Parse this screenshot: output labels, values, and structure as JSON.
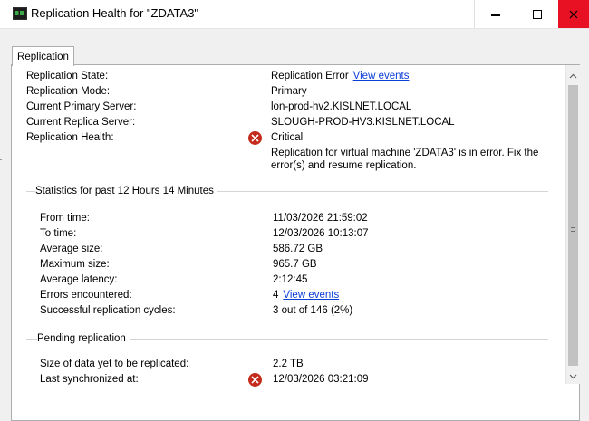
{
  "window": {
    "title": "Replication Health for \"ZDATA3\""
  },
  "tabs": [
    {
      "label": "Replication",
      "active": true
    }
  ],
  "summary": {
    "rows": [
      {
        "label": "Replication State:",
        "value": "Replication Error",
        "link": "View events"
      },
      {
        "label": "Replication Mode:",
        "value": "Primary"
      },
      {
        "label": "Current Primary Server:",
        "value": "lon-prod-hv2.KISLNET.LOCAL"
      },
      {
        "label": "Current Replica Server:",
        "value": "SLOUGH-PROD-HV3.KISLNET.LOCAL"
      },
      {
        "label": "Replication Health:",
        "value": "Critical",
        "icon": "error-icon"
      }
    ],
    "health_message_line1": "Replication for virtual machine 'ZDATA3' is in error. Fix the",
    "health_message_line2": "error(s) and resume replication."
  },
  "statistics": {
    "title": "Statistics for past 12 Hours 14 Minutes",
    "rows": [
      {
        "label": "From time:",
        "value": "11/03/2026 21:59:02"
      },
      {
        "label": "To time:",
        "value": "12/03/2026 10:13:07"
      },
      {
        "label": "Average size:",
        "value": "586.72 GB"
      },
      {
        "label": "Maximum size:",
        "value": "965.7 GB"
      },
      {
        "label": "Average latency:",
        "value": "2:12:45"
      },
      {
        "label": "Errors encountered:",
        "value": "4",
        "link": "View events"
      },
      {
        "label": "Successful replication cycles:",
        "value": "3 out of 146 (2%)"
      }
    ]
  },
  "pending": {
    "title": "Pending replication",
    "rows": [
      {
        "label": "Size of data yet to be replicated:",
        "value": "2.2 TB"
      },
      {
        "label": "Last synchronized at:",
        "value": "12/03/2026 03:21:09",
        "icon": "error-icon"
      }
    ]
  },
  "colors": {
    "link": "#0a3ed8",
    "error": "#c42b1c",
    "close_button": "#e81123"
  }
}
